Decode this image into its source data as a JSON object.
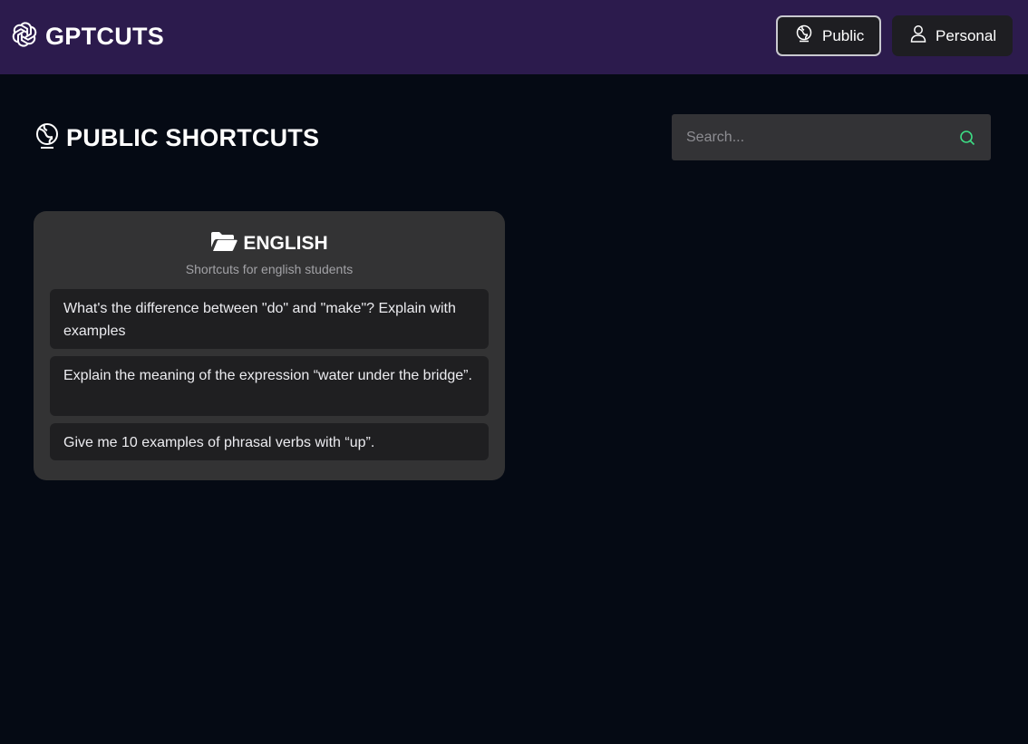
{
  "header": {
    "brand": "GPTCUTS",
    "brand_icon": "openai-logo-icon",
    "nav": [
      {
        "label": "Public",
        "icon": "globe-icon",
        "active": true
      },
      {
        "label": "Personal",
        "icon": "user-icon",
        "active": false
      }
    ]
  },
  "main": {
    "title": "PUBLIC SHORTCUTS",
    "title_icon": "globe-icon",
    "search": {
      "placeholder": "Search...",
      "value": "",
      "icon": "search-icon"
    },
    "categories": [
      {
        "title": "ENGLISH",
        "icon": "folder-open-icon",
        "description": "Shortcuts for english students",
        "shortcuts": [
          "What's the difference between \"do\" and \"make\"? Explain with examples",
          "Explain the meaning of the expression “water under the bridge”.",
          "Give me 10 examples of phrasal verbs with “up”."
        ]
      }
    ]
  },
  "colors": {
    "header_bg": "#2c1b4d",
    "page_bg": "#050a14",
    "card_bg": "#333334",
    "item_bg": "#1f1f21",
    "search_icon": "#3ddc84"
  }
}
